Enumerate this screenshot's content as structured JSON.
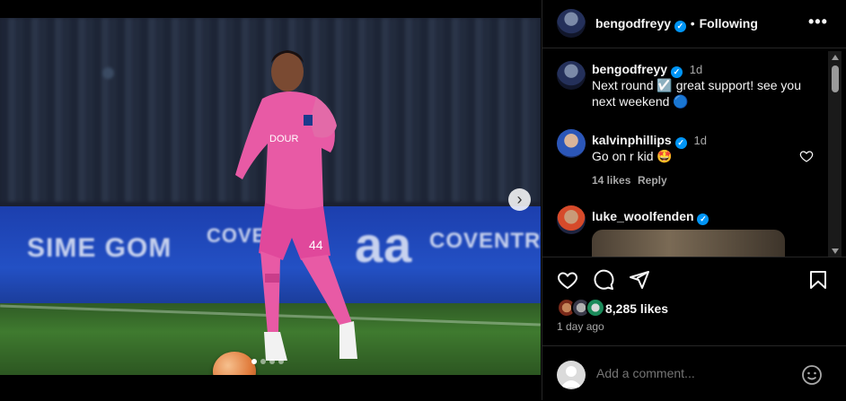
{
  "post": {
    "media_next_label": "›",
    "hoarding_left": "SIME GOM",
    "hoarding_mid": "COVENTRY",
    "hoarding_right": "COVENTRY",
    "hoarding_sign": "aa",
    "player_number": "44"
  },
  "header": {
    "username": "bengodfreyy",
    "verified_glyph": "✓",
    "separator": "•",
    "follow_status": "Following",
    "more_glyph": "•••"
  },
  "caption": {
    "username": "bengodfreyy",
    "time": "1d",
    "text_line1": "Next round ☑️ great support! see you",
    "text_line2": "next weekend 🔵"
  },
  "comments": [
    {
      "username": "kalvinphillips",
      "time": "1d",
      "text": "Go on r kid 🤩",
      "likes": "14 likes",
      "reply": "Reply"
    },
    {
      "username": "luke_woolfenden"
    }
  ],
  "engagement": {
    "likes": "8,285 likes",
    "date": "1 day ago"
  },
  "add_comment": {
    "placeholder": "Add a comment..."
  },
  "colors": {
    "verified": "#0095f6",
    "jersey": "#e85aa5",
    "background": "#000000"
  },
  "icons": [
    "heart-icon",
    "comment-icon",
    "share-icon",
    "bookmark-icon",
    "emoji-icon",
    "more-icon",
    "chevron-right-icon"
  ]
}
